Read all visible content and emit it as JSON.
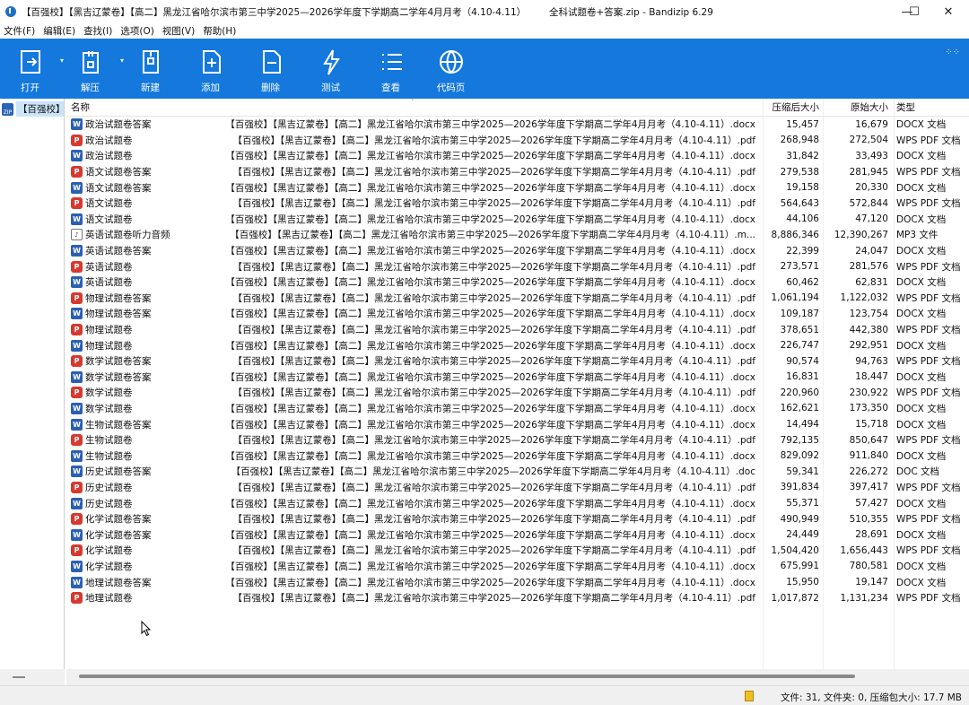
{
  "window": {
    "title_left": "【百强校】【黑吉辽蒙卷】【高二】黑龙江省哈尔滨市第三中学2025—2026学年度下学期高二学年4月月考（4.10-4.11）",
    "title_right": "全科试题卷+答案.zip - Bandizip 6.29",
    "minimize": "—",
    "maximize": "☐",
    "close": "✕"
  },
  "menu": [
    "文件(F)",
    "编辑(E)",
    "查找(I)",
    "选项(O)",
    "视图(V)",
    "帮助(H)"
  ],
  "toolbar": [
    {
      "label": "打开",
      "icon": "open-icon",
      "dropdown": true
    },
    {
      "label": "解压",
      "icon": "extract-icon",
      "dropdown": true
    },
    {
      "label": "新建",
      "icon": "new-archive-icon",
      "dropdown": false
    },
    {
      "label": "添加",
      "icon": "add-icon",
      "dropdown": false
    },
    {
      "label": "删除",
      "icon": "delete-icon",
      "dropdown": false
    },
    {
      "label": "测试",
      "icon": "test-icon",
      "dropdown": false
    },
    {
      "label": "查看",
      "icon": "view-icon",
      "dropdown": false
    },
    {
      "label": "代码页",
      "icon": "codepage-icon",
      "dropdown": false
    }
  ],
  "tree": {
    "root_label": "【百强校】"
  },
  "columns": {
    "name": "名称",
    "packed": "压缩后大小",
    "original": "原始大小",
    "type": "类型"
  },
  "prefix": "【百强校】【黑吉辽蒙卷】【高二】黑龙江省哈尔滨市第三中学2025—2026学年度下学期高二学年4月月考（4.10-4.11）",
  "files": [
    {
      "n1": "政治试题卷答案",
      "n2": "【百强校】【黑吉辽蒙卷】【高二】黑龙江省哈尔滨市第三中学2025—2026学年度下学期高二学年4月月考（4.10-4.11）.docx",
      "packed": "15,457",
      "orig": "16,679",
      "type": "DOCX 文档",
      "icon": "w"
    },
    {
      "n1": "政治试题卷",
      "n2": "【百强校】【黑吉辽蒙卷】【高二】黑龙江省哈尔滨市第三中学2025—2026学年度下学期高二学年4月月考（4.10-4.11）.pdf",
      "packed": "268,948",
      "orig": "272,504",
      "type": "WPS PDF 文档",
      "icon": "p"
    },
    {
      "n1": "政治试题卷",
      "n2": "【百强校】【黑吉辽蒙卷】【高二】黑龙江省哈尔滨市第三中学2025—2026学年度下学期高二学年4月月考（4.10-4.11）.docx",
      "packed": "31,842",
      "orig": "33,493",
      "type": "DOCX 文档",
      "icon": "w"
    },
    {
      "n1": "语文试题卷答案",
      "n2": "【百强校】【黑吉辽蒙卷】【高二】黑龙江省哈尔滨市第三中学2025—2026学年度下学期高二学年4月月考（4.10-4.11）.pdf",
      "packed": "279,538",
      "orig": "281,945",
      "type": "WPS PDF 文档",
      "icon": "p"
    },
    {
      "n1": "语文试题卷答案",
      "n2": "【百强校】【黑吉辽蒙卷】【高二】黑龙江省哈尔滨市第三中学2025—2026学年度下学期高二学年4月月考（4.10-4.11）.docx",
      "packed": "19,158",
      "orig": "20,330",
      "type": "DOCX 文档",
      "icon": "w"
    },
    {
      "n1": "语文试题卷",
      "n2": "【百强校】【黑吉辽蒙卷】【高二】黑龙江省哈尔滨市第三中学2025—2026学年度下学期高二学年4月月考（4.10-4.11）.pdf",
      "packed": "564,643",
      "orig": "572,844",
      "type": "WPS PDF 文档",
      "icon": "p"
    },
    {
      "n1": "语文试题卷",
      "n2": "【百强校】【黑吉辽蒙卷】【高二】黑龙江省哈尔滨市第三中学2025—2026学年度下学期高二学年4月月考（4.10-4.11）.docx",
      "packed": "44,106",
      "orig": "47,120",
      "type": "DOCX 文档",
      "icon": "w"
    },
    {
      "n1": "英语试题卷听力音频",
      "n2": "【百强校】【黑吉辽蒙卷】【高二】黑龙江省哈尔滨市第三中学2025—2026学年度下学期高二学年4月月考（4.10-4.11）.m...",
      "packed": "8,886,346",
      "orig": "12,390,267",
      "type": "MP3 文件",
      "icon": "m"
    },
    {
      "n1": "英语试题卷答案",
      "n2": "【百强校】【黑吉辽蒙卷】【高二】黑龙江省哈尔滨市第三中学2025—2026学年度下学期高二学年4月月考（4.10-4.11）.docx",
      "packed": "22,399",
      "orig": "24,047",
      "type": "DOCX 文档",
      "icon": "w"
    },
    {
      "n1": "英语试题卷",
      "n2": "【百强校】【黑吉辽蒙卷】【高二】黑龙江省哈尔滨市第三中学2025—2026学年度下学期高二学年4月月考（4.10-4.11）.pdf",
      "packed": "273,571",
      "orig": "281,576",
      "type": "WPS PDF 文档",
      "icon": "p"
    },
    {
      "n1": "英语试题卷",
      "n2": "【百强校】【黑吉辽蒙卷】【高二】黑龙江省哈尔滨市第三中学2025—2026学年度下学期高二学年4月月考（4.10-4.11）.docx",
      "packed": "60,462",
      "orig": "62,831",
      "type": "DOCX 文档",
      "icon": "w"
    },
    {
      "n1": "物理试题卷答案",
      "n2": "【百强校】【黑吉辽蒙卷】【高二】黑龙江省哈尔滨市第三中学2025—2026学年度下学期高二学年4月月考（4.10-4.11）.pdf",
      "packed": "1,061,194",
      "orig": "1,122,032",
      "type": "WPS PDF 文档",
      "icon": "p"
    },
    {
      "n1": "物理试题卷答案",
      "n2": "【百强校】【黑吉辽蒙卷】【高二】黑龙江省哈尔滨市第三中学2025—2026学年度下学期高二学年4月月考（4.10-4.11）.docx",
      "packed": "109,187",
      "orig": "123,754",
      "type": "DOCX 文档",
      "icon": "w"
    },
    {
      "n1": "物理试题卷",
      "n2": "【百强校】【黑吉辽蒙卷】【高二】黑龙江省哈尔滨市第三中学2025—2026学年度下学期高二学年4月月考（4.10-4.11）.pdf",
      "packed": "378,651",
      "orig": "442,380",
      "type": "WPS PDF 文档",
      "icon": "p"
    },
    {
      "n1": "物理试题卷",
      "n2": "【百强校】【黑吉辽蒙卷】【高二】黑龙江省哈尔滨市第三中学2025—2026学年度下学期高二学年4月月考（4.10-4.11）.docx",
      "packed": "226,747",
      "orig": "292,951",
      "type": "DOCX 文档",
      "icon": "w"
    },
    {
      "n1": "数学试题卷答案",
      "n2": "【百强校】【黑吉辽蒙卷】【高二】黑龙江省哈尔滨市第三中学2025—2026学年度下学期高二学年4月月考（4.10-4.11）.pdf",
      "packed": "90,574",
      "orig": "94,763",
      "type": "WPS PDF 文档",
      "icon": "p"
    },
    {
      "n1": "数学试题卷答案",
      "n2": "【百强校】【黑吉辽蒙卷】【高二】黑龙江省哈尔滨市第三中学2025—2026学年度下学期高二学年4月月考（4.10-4.11）.docx",
      "packed": "16,831",
      "orig": "18,447",
      "type": "DOCX 文档",
      "icon": "w"
    },
    {
      "n1": "数学试题卷",
      "n2": "【百强校】【黑吉辽蒙卷】【高二】黑龙江省哈尔滨市第三中学2025—2026学年度下学期高二学年4月月考（4.10-4.11）.pdf",
      "packed": "220,960",
      "orig": "230,922",
      "type": "WPS PDF 文档",
      "icon": "p"
    },
    {
      "n1": "数学试题卷",
      "n2": "【百强校】【黑吉辽蒙卷】【高二】黑龙江省哈尔滨市第三中学2025—2026学年度下学期高二学年4月月考（4.10-4.11）.docx",
      "packed": "162,621",
      "orig": "173,350",
      "type": "DOCX 文档",
      "icon": "w"
    },
    {
      "n1": "生物试题卷答案",
      "n2": "【百强校】【黑吉辽蒙卷】【高二】黑龙江省哈尔滨市第三中学2025—2026学年度下学期高二学年4月月考（4.10-4.11）.docx",
      "packed": "14,494",
      "orig": "15,718",
      "type": "DOCX 文档",
      "icon": "w"
    },
    {
      "n1": "生物试题卷",
      "n2": "【百强校】【黑吉辽蒙卷】【高二】黑龙江省哈尔滨市第三中学2025—2026学年度下学期高二学年4月月考（4.10-4.11）.pdf",
      "packed": "792,135",
      "orig": "850,647",
      "type": "WPS PDF 文档",
      "icon": "p"
    },
    {
      "n1": "生物试题卷",
      "n2": "【百强校】【黑吉辽蒙卷】【高二】黑龙江省哈尔滨市第三中学2025—2026学年度下学期高二学年4月月考（4.10-4.11）.docx",
      "packed": "829,092",
      "orig": "911,840",
      "type": "DOCX 文档",
      "icon": "w"
    },
    {
      "n1": "历史试题卷答案",
      "n2": "【百强校】【黑吉辽蒙卷】【高二】黑龙江省哈尔滨市第三中学2025—2026学年度下学期高二学年4月月考（4.10-4.11）.doc",
      "packed": "59,341",
      "orig": "226,272",
      "type": "DOC 文档",
      "icon": "w"
    },
    {
      "n1": "历史试题卷",
      "n2": "【百强校】【黑吉辽蒙卷】【高二】黑龙江省哈尔滨市第三中学2025—2026学年度下学期高二学年4月月考（4.10-4.11）.pdf",
      "packed": "391,834",
      "orig": "397,417",
      "type": "WPS PDF 文档",
      "icon": "p"
    },
    {
      "n1": "历史试题卷",
      "n2": "【百强校】【黑吉辽蒙卷】【高二】黑龙江省哈尔滨市第三中学2025—2026学年度下学期高二学年4月月考（4.10-4.11）.docx",
      "packed": "55,371",
      "orig": "57,427",
      "type": "DOCX 文档",
      "icon": "w"
    },
    {
      "n1": "化学试题卷答案",
      "n2": "【百强校】【黑吉辽蒙卷】【高二】黑龙江省哈尔滨市第三中学2025—2026学年度下学期高二学年4月月考（4.10-4.11）.pdf",
      "packed": "490,949",
      "orig": "510,355",
      "type": "WPS PDF 文档",
      "icon": "p"
    },
    {
      "n1": "化学试题卷答案",
      "n2": "【百强校】【黑吉辽蒙卷】【高二】黑龙江省哈尔滨市第三中学2025—2026学年度下学期高二学年4月月考（4.10-4.11）.docx",
      "packed": "24,449",
      "orig": "28,691",
      "type": "DOCX 文档",
      "icon": "w"
    },
    {
      "n1": "化学试题卷",
      "n2": "【百强校】【黑吉辽蒙卷】【高二】黑龙江省哈尔滨市第三中学2025—2026学年度下学期高二学年4月月考（4.10-4.11）.pdf",
      "packed": "1,504,420",
      "orig": "1,656,443",
      "type": "WPS PDF 文档",
      "icon": "p"
    },
    {
      "n1": "化学试题卷",
      "n2": "【百强校】【黑吉辽蒙卷】【高二】黑龙江省哈尔滨市第三中学2025—2026学年度下学期高二学年4月月考（4.10-4.11）.docx",
      "packed": "675,991",
      "orig": "780,581",
      "type": "DOCX 文档",
      "icon": "w"
    },
    {
      "n1": "地理试题卷答案",
      "n2": "【百强校】【黑吉辽蒙卷】【高二】黑龙江省哈尔滨市第三中学2025—2026学年度下学期高二学年4月月考（4.10-4.11）.docx",
      "packed": "15,950",
      "orig": "19,147",
      "type": "DOCX 文档",
      "icon": "w"
    },
    {
      "n1": "地理试题卷",
      "n2": "【百强校】【黑吉辽蒙卷】【高二】黑龙江省哈尔滨市第三中学2025—2026学年度下学期高二学年4月月考（4.10-4.11）.pdf",
      "packed": "1,017,872",
      "orig": "1,131,234",
      "type": "WPS PDF 文档",
      "icon": "p"
    }
  ],
  "status": {
    "text": "文件: 31, 文件夹: 0, 压缩包大小: 17.7 MB"
  },
  "colors": {
    "toolbar": "#1478dc",
    "word": "#2b5fb4",
    "pdf": "#d8382e"
  }
}
